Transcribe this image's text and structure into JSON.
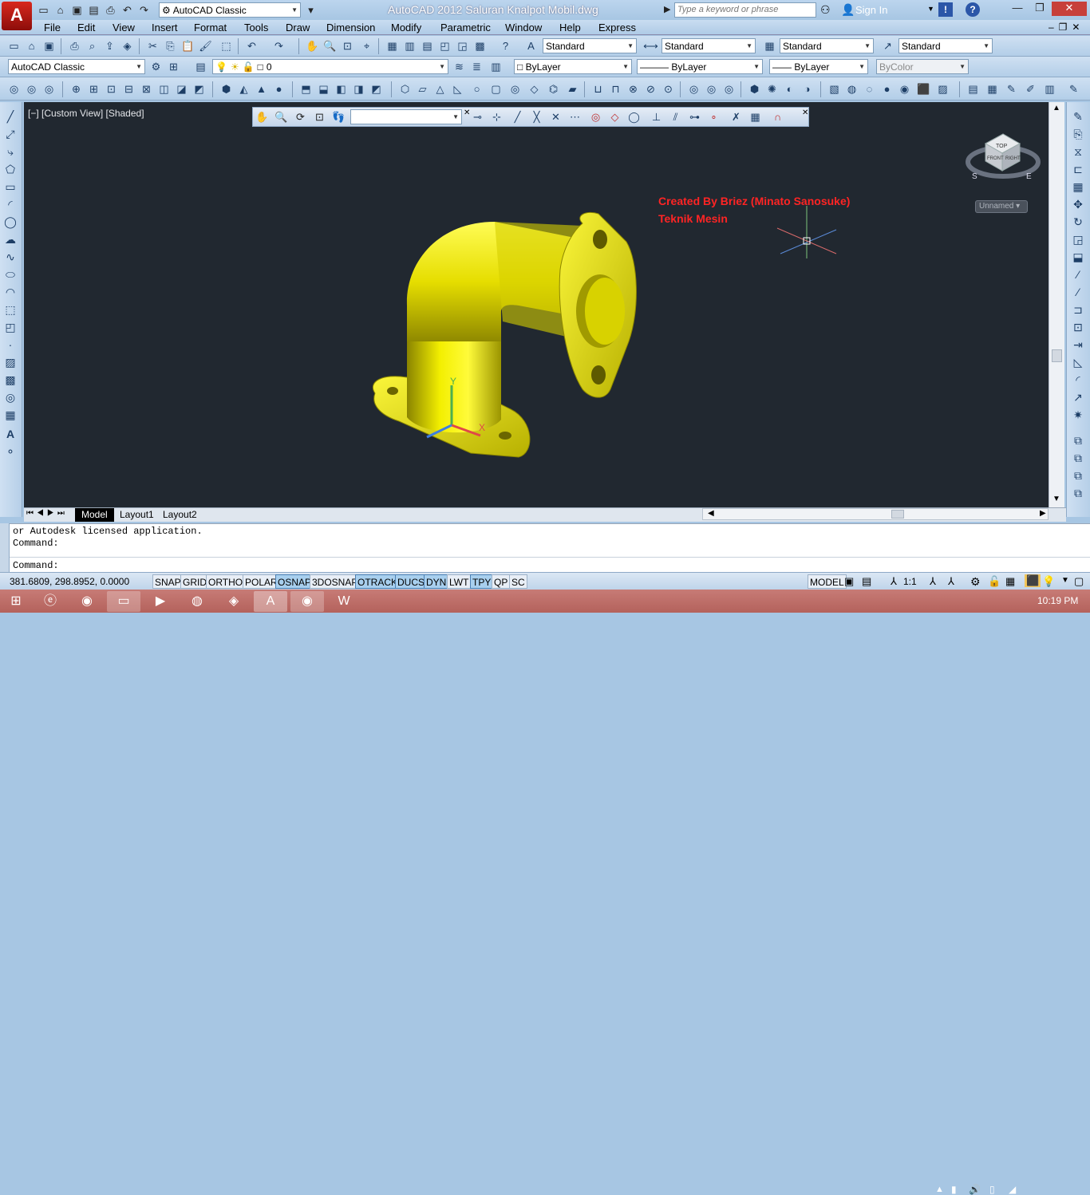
{
  "title": {
    "workspace": "AutoCAD Classic",
    "text": "AutoCAD 2012    Saluran Knalpot Mobil.dwg",
    "search_placeholder": "Type a keyword or phrase",
    "sign_in": "Sign In",
    "logo_letter": "A"
  },
  "menu": [
    "File",
    "Edit",
    "View",
    "Insert",
    "Format",
    "Tools",
    "Draw",
    "Dimension",
    "Modify",
    "Parametric",
    "Window",
    "Help",
    "Express"
  ],
  "styles": {
    "text_style": "Standard",
    "dim_style": "Standard",
    "table_style": "Standard",
    "mleader_style": "Standard"
  },
  "layers": {
    "workspace": "AutoCAD Classic",
    "layer": "0",
    "color": "ByLayer",
    "linetype": "ByLayer",
    "lineweight": "ByLayer",
    "plotstyle": "ByColor"
  },
  "viewport": {
    "label": "[−] [Custom View] [Shaded]",
    "annotation_line1": "Created By Briez (Minato Sanosuke)",
    "annotation_line2": "Teknik Mesin",
    "viewcube_label": "Unnamed",
    "cube_top": "TOP",
    "cube_front": "FRONT",
    "cube_right": "RIGHT",
    "compass_s": "S",
    "compass_e": "E",
    "axis_x": "X",
    "axis_y": "Y"
  },
  "tabs": [
    "Model",
    "Layout1",
    "Layout2"
  ],
  "command": {
    "line1": "or Autodesk licensed application.",
    "line2": "Command:",
    "prompt": "Command:"
  },
  "status": {
    "coords": "381.6809, 298.8952, 0.0000",
    "toggles": [
      "SNAP",
      "GRID",
      "ORTHO",
      "POLAR",
      "OSNAP",
      "3DOSNAP",
      "OTRACK",
      "DUCS",
      "DYN",
      "LWT",
      "TPY",
      "QP",
      "SC"
    ],
    "model": "MODEL",
    "scale": "1:1"
  },
  "taskbar": {
    "time": "10:19 PM"
  }
}
